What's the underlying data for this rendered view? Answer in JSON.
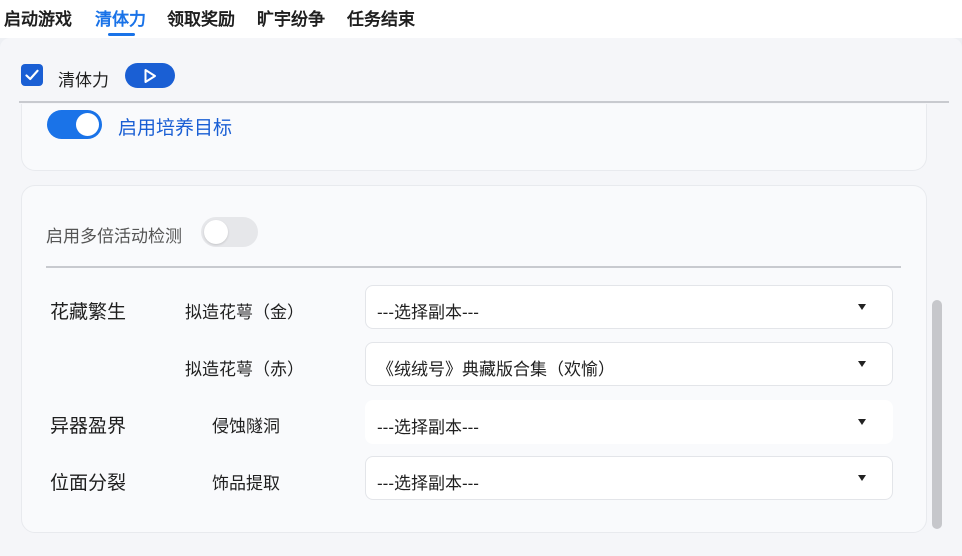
{
  "tabs": [
    {
      "label": "启动游戏"
    },
    {
      "label": "清体力",
      "active": true
    },
    {
      "label": "领取奖励"
    },
    {
      "label": "旷宇纷争"
    },
    {
      "label": "任务结束"
    }
  ],
  "section": {
    "checked": true,
    "label": "清体力"
  },
  "cultivation_toggle": {
    "on": true,
    "label": "启用培养目标"
  },
  "multiplier_toggle": {
    "on": false,
    "label": "启用多倍活动检测"
  },
  "groups": [
    {
      "category": "花藏繁生",
      "rows": [
        {
          "label": "拟造花萼（金）",
          "value": "---选择副本---"
        },
        {
          "label": "拟造花萼（赤）",
          "value": "《绒绒号》典藏版合集（欢愉）"
        }
      ]
    },
    {
      "category": "异器盈界",
      "rows": [
        {
          "label": "侵蚀隧洞",
          "value": "---选择副本---"
        }
      ]
    },
    {
      "category": "位面分裂",
      "rows": [
        {
          "label": "饰品提取",
          "value": "---选择副本---"
        }
      ]
    }
  ],
  "colors": {
    "accent": "#1a73e8",
    "accent_dark": "#1a5fd4"
  },
  "icons": {
    "run": "play-icon",
    "check": "checkmark-icon",
    "dropdown": "caret-down-icon"
  }
}
